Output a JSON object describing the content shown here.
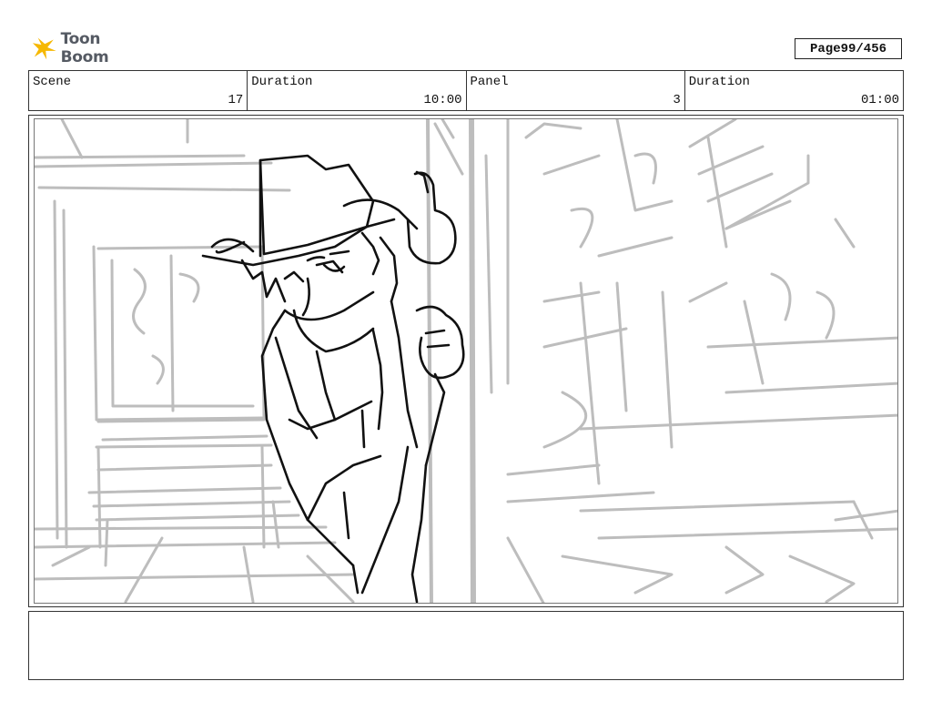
{
  "brand": {
    "name": "Toon Boom"
  },
  "page": {
    "label": "Page",
    "number": "99/456"
  },
  "header": {
    "scene_label": "Scene",
    "scene_value": "17",
    "duration_label": "Duration",
    "duration_value": "10:00",
    "panel_label": "Panel",
    "panel_value": "3",
    "panel_duration_label": "Duration",
    "panel_duration_value": "01:00"
  },
  "notes": {
    "text": ""
  },
  "colors": {
    "sketch_dark": "#111111",
    "sketch_light": "#bdbdbd",
    "logo_yellow": "#f6b800",
    "logo_text": "#555a63"
  }
}
